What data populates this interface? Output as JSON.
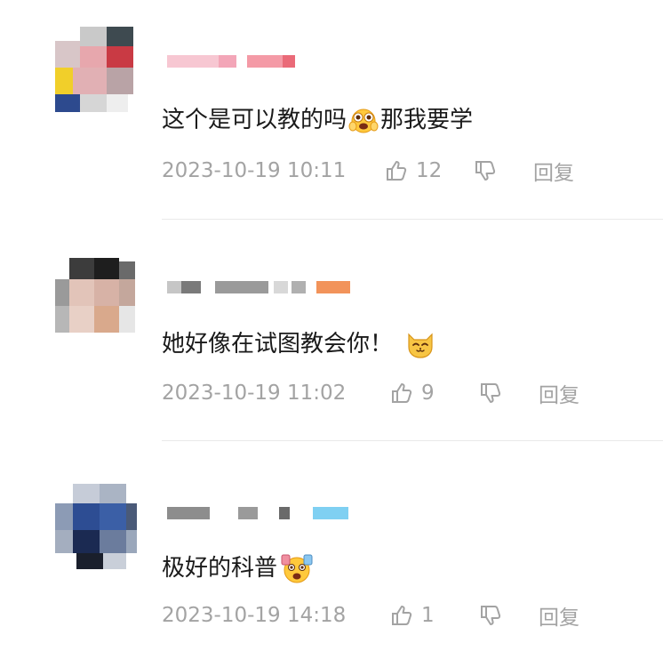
{
  "comments": [
    {
      "text_a": "这个是可以教的吗",
      "emoji_a": "excited-face-emoji",
      "text_b": "那我要学",
      "time": "2023-10-19 10:11",
      "likes": "12",
      "reply_label": "回复"
    },
    {
      "text_a": "她好像在试图教会你！",
      "emoji_a": "cat-face-emoji",
      "time": "2023-10-19 11:02",
      "likes": "9",
      "reply_label": "回复"
    },
    {
      "text_a": "极好的科普",
      "emoji_a": "shocked-face-emoji",
      "time": "2023-10-19 14:18",
      "likes": "1",
      "reply_label": "回复"
    }
  ]
}
